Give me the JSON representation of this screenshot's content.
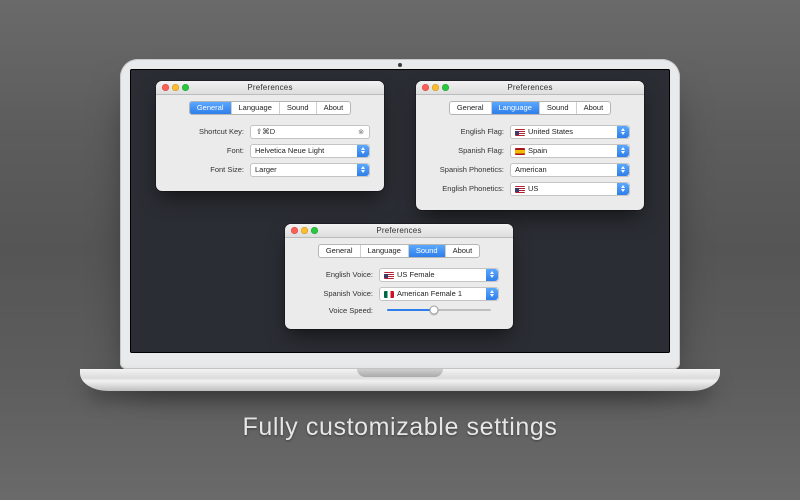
{
  "caption": "Fully customizable settings",
  "tabs": {
    "general": "General",
    "language": "Language",
    "sound": "Sound",
    "about": "About"
  },
  "shared_title": "Preferences",
  "win_general": {
    "labels": {
      "shortcut": "Shortcut Key:",
      "font": "Font:",
      "font_size": "Font Size:"
    },
    "values": {
      "shortcut": "⇧⌘D",
      "font": "Helvetica Neue Light",
      "font_size": "Larger"
    }
  },
  "win_language": {
    "labels": {
      "eng_flag": "English Flag:",
      "spa_flag": "Spanish Flag:",
      "spa_phon": "Spanish Phonetics:",
      "eng_phon": "English Phonetics:"
    },
    "values": {
      "eng_flag": "United States",
      "spa_flag": "Spain",
      "spa_phon": "American",
      "eng_phon": "US"
    }
  },
  "win_sound": {
    "labels": {
      "eng_voice": "English Voice:",
      "spa_voice": "Spanish Voice:",
      "speed": "Voice Speed:"
    },
    "values": {
      "eng_voice": "US Female",
      "spa_voice": "American Female 1"
    }
  }
}
